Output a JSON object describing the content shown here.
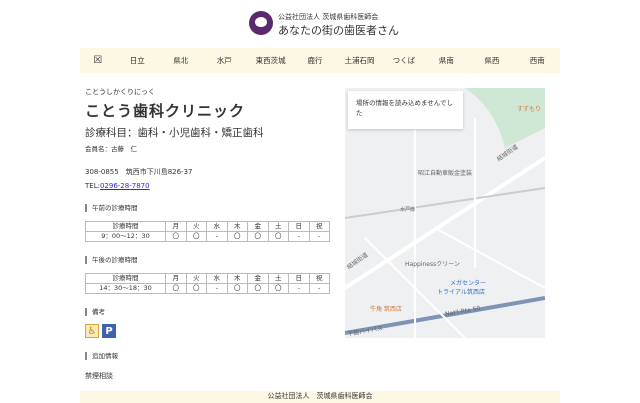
{
  "header": {
    "org": "公益社団法人 茨城県歯科医師会",
    "site_title": "あなたの街の歯医者さん"
  },
  "nav": {
    "items": [
      "日立",
      "県北",
      "水戸",
      "東西茨城",
      "鹿行",
      "土浦石岡",
      "つくば",
      "県南",
      "県西",
      "西南"
    ]
  },
  "clinic": {
    "kana": "ことうしかくりにっく",
    "name": "ことう歯科クリニック",
    "departments": "診療科目：歯科・小児歯科・矯正歯科",
    "member": "会員名：古藤　仁",
    "address": "308-0855　筑西市下川島826-37",
    "tel_label": "TEL:",
    "tel": "0296-28-7870"
  },
  "morning": {
    "title": "午前の診療時間",
    "header": [
      "診療時間",
      "月",
      "火",
      "水",
      "木",
      "金",
      "土",
      "日",
      "祝"
    ],
    "row": [
      "9：00～12：30",
      "〇",
      "〇",
      "-",
      "〇",
      "〇",
      "〇",
      "-",
      "-"
    ]
  },
  "afternoon": {
    "title": "午後の診療時間",
    "header": [
      "診療時間",
      "月",
      "火",
      "水",
      "木",
      "金",
      "土",
      "日",
      "祝"
    ],
    "row": [
      "14：30～18：30",
      "〇",
      "〇",
      "-",
      "〇",
      "〇",
      "〇",
      "-",
      "-"
    ]
  },
  "notes": {
    "title": "備考",
    "icons": [
      "wheelchair-icon",
      "parking-icon"
    ],
    "wheelchair": "♿",
    "parking": "P"
  },
  "extra": {
    "title": "追加情報",
    "text": "禁煙相談"
  },
  "map": {
    "error": "場所の情報を読み込めませんでした",
    "labels": [
      "すずもり",
      "昭江自動車販金塗装",
      "水戸線",
      "結城街道",
      "結城街道",
      "Happinessクリーン",
      "メガセンター",
      "トライアル筑西店",
      "牛角 筑西店",
      "Nat'l Rte 50",
      "下館バイパス"
    ]
  },
  "footer": {
    "text": "公益社団法人　茨城県歯科医師会"
  },
  "colors": {
    "brand": "#5a2a6e",
    "nav_bg": "#fdf8e3",
    "link": "#2a2ad0"
  }
}
